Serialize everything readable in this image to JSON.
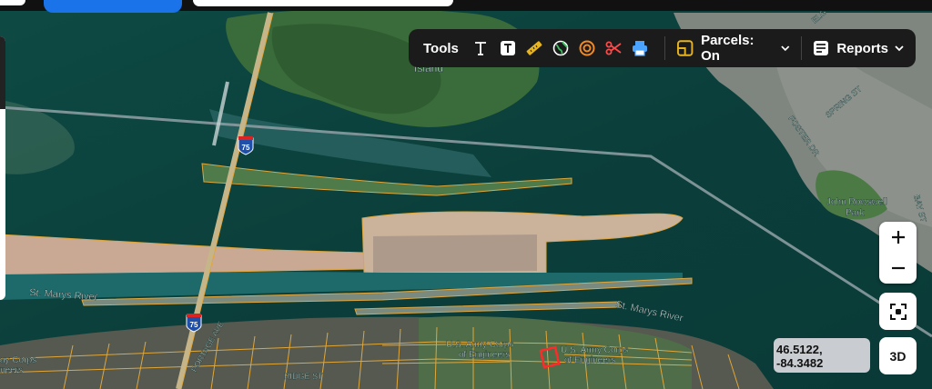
{
  "toolbar": {
    "tools_label": "Tools",
    "parcels_label": "Parcels: On",
    "reports_label": "Reports",
    "icons": [
      "text-tool-icon",
      "text-box-icon",
      "ruler-icon",
      "globe-icon",
      "buffer-ring-icon",
      "scissors-icon",
      "print-icon"
    ]
  },
  "map_labels": {
    "island": "Island",
    "river_left": "St. Marys River",
    "river_right": "St. Marys River",
    "i75_north": "75",
    "i75_south": "75",
    "foster_dr": "FOSTER DR",
    "spring_st": "SPRING ST",
    "park": "John Rowswell",
    "park2": "Park",
    "bay_st": "BAY ST",
    "elg": "ELG",
    "army_corps_1a": "U.S. Army Corps",
    "army_corps_1b": "of Engineers",
    "army_corps_2a": "U.S. Army Corps",
    "army_corps_2b": "of Engineers",
    "army_corps_3a": "ay Corps",
    "army_corps_3b": "neers",
    "portage_ave": "PORTAGE AVE",
    "ridge_st": "RIDGE ST"
  },
  "coords": {
    "lat": "46.5122,",
    "lon": "-84.3482"
  },
  "controls": {
    "zoom_in": "+",
    "zoom_out": "−",
    "three_d": "3D"
  },
  "colors": {
    "parcel": "#e0a63a",
    "selected": "#ff2a2a",
    "toolbar": "#1b1b1b"
  }
}
